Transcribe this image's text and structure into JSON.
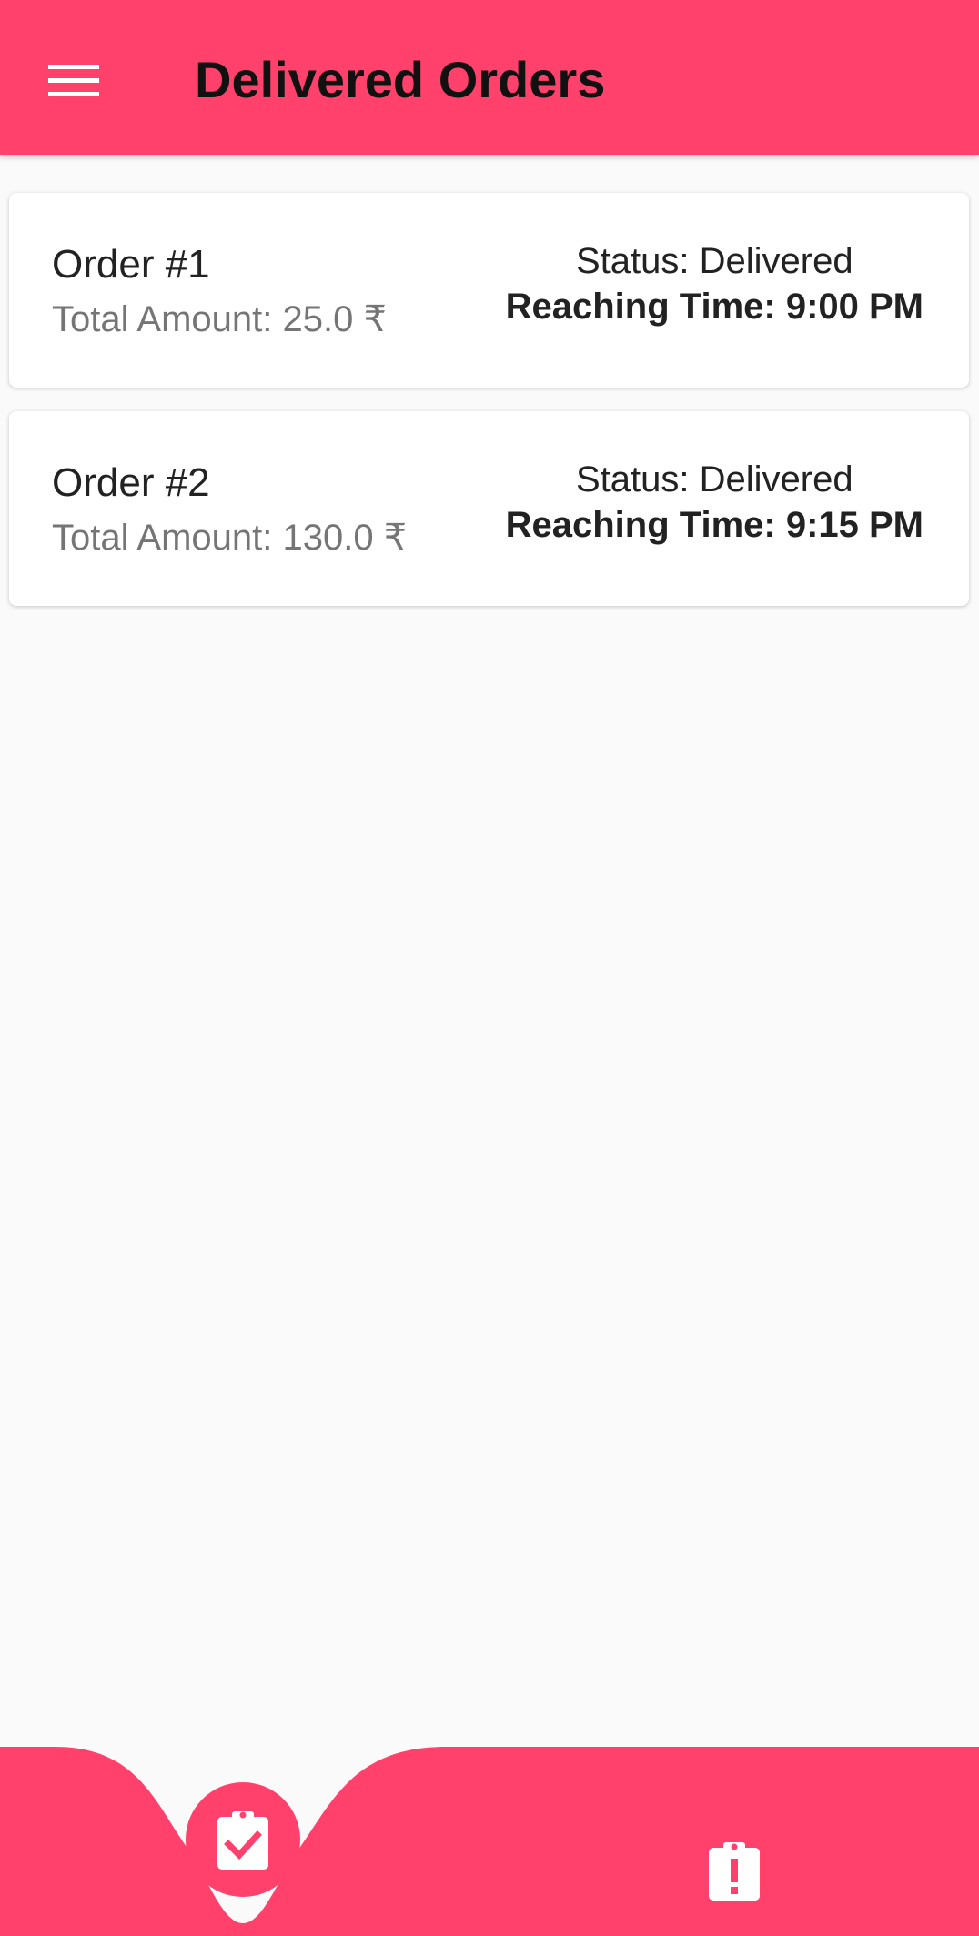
{
  "header": {
    "title": "Delivered Orders",
    "menu_icon": "menu-icon",
    "color": "#ff416c"
  },
  "orders": [
    {
      "title": "Order #1",
      "amount": "Total Amount:  25.0 ₹",
      "status": "Status: Delivered",
      "reaching_time": "Reaching Time: 9:00 PM"
    },
    {
      "title": "Order #2",
      "amount": "Total Amount:  130.0 ₹",
      "status": "Status: Delivered",
      "reaching_time": "Reaching Time: 9:15 PM"
    }
  ],
  "bottom_nav": {
    "items": [
      {
        "icon": "clipboard-check-icon",
        "active": true
      },
      {
        "icon": "clipboard-alert-icon",
        "active": false
      }
    ],
    "color": "#ff416c"
  }
}
